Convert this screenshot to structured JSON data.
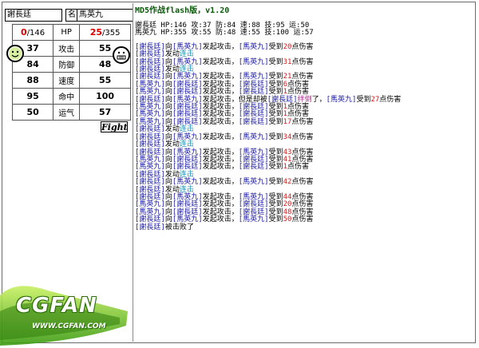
{
  "players": {
    "p1": {
      "name": "謝長廷",
      "hp_cur": "0",
      "hp_max": "/146",
      "atk": "37",
      "def": "84",
      "spd": "88",
      "hit": "95",
      "luck": "50"
    },
    "p2": {
      "name": "馬英九",
      "hp_cur": "25",
      "hp_max": "/355",
      "atk": "55",
      "def": "48",
      "spd": "55",
      "hit": "100",
      "luck": "57"
    }
  },
  "labels": {
    "name": "名",
    "hp": "HP",
    "atk": "攻击",
    "def": "防御",
    "spd": "速度",
    "hit": "命中",
    "luck": "运气"
  },
  "fight_button": "Fight",
  "log": {
    "title": "MD5作战flash版，v1.20",
    "stats_line1": "謝長廷  HP:146 攻:37 防:84 速:88 技:95 运:50",
    "stats_line2": "馬英九  HP:355 攻:55 防:48 速:55 技:100 运:57",
    "entries": [
      [
        {
          "t": "[謝長廷]",
          "c": "blue"
        },
        {
          "t": "向"
        },
        {
          "t": "[馬英九]",
          "c": "blue"
        },
        {
          "t": "发起攻击，"
        },
        {
          "t": "[馬英九]",
          "c": "blue"
        },
        {
          "t": "受到"
        },
        {
          "t": "20",
          "c": "red"
        },
        {
          "t": "点伤害"
        }
      ],
      [
        {
          "t": "[謝長廷]",
          "c": "blue"
        },
        {
          "t": "发动"
        },
        {
          "t": "连击",
          "c": "cyan"
        }
      ],
      [
        {
          "t": "[謝長廷]",
          "c": "blue"
        },
        {
          "t": "向"
        },
        {
          "t": "[馬英九]",
          "c": "blue"
        },
        {
          "t": "发起攻击，"
        },
        {
          "t": "[馬英九]",
          "c": "blue"
        },
        {
          "t": "受到"
        },
        {
          "t": "31",
          "c": "red"
        },
        {
          "t": "点伤害"
        }
      ],
      [
        {
          "t": "[謝長廷]",
          "c": "blue"
        },
        {
          "t": "发动"
        },
        {
          "t": "连击",
          "c": "cyan"
        }
      ],
      [
        {
          "t": "[謝長廷]",
          "c": "blue"
        },
        {
          "t": "向"
        },
        {
          "t": "[馬英九]",
          "c": "blue"
        },
        {
          "t": "发起攻击，"
        },
        {
          "t": "[馬英九]",
          "c": "blue"
        },
        {
          "t": "受到"
        },
        {
          "t": "21",
          "c": "red"
        },
        {
          "t": "点伤害"
        }
      ],
      [
        {
          "t": "[馬英九]",
          "c": "blue"
        },
        {
          "t": "向"
        },
        {
          "t": "[謝長廷]",
          "c": "blue"
        },
        {
          "t": "发起攻击，"
        },
        {
          "t": "[謝長廷]",
          "c": "blue"
        },
        {
          "t": "受到"
        },
        {
          "t": "6",
          "c": "red"
        },
        {
          "t": "点伤害"
        }
      ],
      [
        {
          "t": "[馬英九]",
          "c": "blue"
        },
        {
          "t": "向"
        },
        {
          "t": "[謝長廷]",
          "c": "blue"
        },
        {
          "t": "发起攻击，"
        },
        {
          "t": "[謝長廷]",
          "c": "blue"
        },
        {
          "t": "受到"
        },
        {
          "t": "1",
          "c": "red"
        },
        {
          "t": "点伤害"
        }
      ],
      [
        {
          "t": "[謝長廷]",
          "c": "blue"
        },
        {
          "t": "向"
        },
        {
          "t": "[馬英九]",
          "c": "blue"
        },
        {
          "t": "发起攻击，但是却被"
        },
        {
          "t": "[謝長廷]",
          "c": "blue"
        },
        {
          "t": "绊倒",
          "c": "pink"
        },
        {
          "t": "了，"
        },
        {
          "t": "[馬英九]",
          "c": "blue"
        },
        {
          "t": "受到"
        },
        {
          "t": "27",
          "c": "red"
        },
        {
          "t": "点伤害"
        }
      ],
      [
        {
          "t": "[馬英九]",
          "c": "blue"
        },
        {
          "t": "向"
        },
        {
          "t": "[謝長廷]",
          "c": "blue"
        },
        {
          "t": "发起攻击，"
        },
        {
          "t": "[謝長廷]",
          "c": "blue"
        },
        {
          "t": "受到"
        },
        {
          "t": "1",
          "c": "red"
        },
        {
          "t": "点伤害"
        }
      ],
      [
        {
          "t": "[馬英九]",
          "c": "blue"
        },
        {
          "t": "向"
        },
        {
          "t": "[謝長廷]",
          "c": "blue"
        },
        {
          "t": "发起攻击，"
        },
        {
          "t": "[謝長廷]",
          "c": "blue"
        },
        {
          "t": "受到"
        },
        {
          "t": "1",
          "c": "red"
        },
        {
          "t": "点伤害"
        }
      ],
      [
        {
          "t": "[馬英九]",
          "c": "blue"
        },
        {
          "t": "向"
        },
        {
          "t": "[謝長廷]",
          "c": "blue"
        },
        {
          "t": "发起攻击，"
        },
        {
          "t": "[謝長廷]",
          "c": "blue"
        },
        {
          "t": "受到"
        },
        {
          "t": "17",
          "c": "red"
        },
        {
          "t": "点伤害"
        }
      ],
      [
        {
          "t": "[謝長廷]",
          "c": "blue"
        },
        {
          "t": "发动"
        },
        {
          "t": "连击",
          "c": "cyan"
        }
      ],
      [
        {
          "t": "[謝長廷]",
          "c": "blue"
        },
        {
          "t": "向"
        },
        {
          "t": "[馬英九]",
          "c": "blue"
        },
        {
          "t": "发起攻击，"
        },
        {
          "t": "[馬英九]",
          "c": "blue"
        },
        {
          "t": "受到"
        },
        {
          "t": "34",
          "c": "red"
        },
        {
          "t": "点伤害"
        }
      ],
      [
        {
          "t": "[謝長廷]",
          "c": "blue"
        },
        {
          "t": "发动"
        },
        {
          "t": "连击",
          "c": "cyan"
        }
      ],
      [
        {
          "t": "[謝長廷]",
          "c": "blue"
        },
        {
          "t": "向"
        },
        {
          "t": "[馬英九]",
          "c": "blue"
        },
        {
          "t": "发起攻击，"
        },
        {
          "t": "[馬英九]",
          "c": "blue"
        },
        {
          "t": "受到"
        },
        {
          "t": "43",
          "c": "red"
        },
        {
          "t": "点伤害"
        }
      ],
      [
        {
          "t": "[馬英九]",
          "c": "blue"
        },
        {
          "t": "向"
        },
        {
          "t": "[謝長廷]",
          "c": "blue"
        },
        {
          "t": "发起攻击，"
        },
        {
          "t": "[謝長廷]",
          "c": "blue"
        },
        {
          "t": "受到"
        },
        {
          "t": "41",
          "c": "red"
        },
        {
          "t": "点伤害"
        }
      ],
      [
        {
          "t": "[馬英九]",
          "c": "blue"
        },
        {
          "t": "向"
        },
        {
          "t": "[謝長廷]",
          "c": "blue"
        },
        {
          "t": "发起攻击，"
        },
        {
          "t": "[謝長廷]",
          "c": "blue"
        },
        {
          "t": "受到"
        },
        {
          "t": "1",
          "c": "red"
        },
        {
          "t": "点伤害"
        }
      ],
      [
        {
          "t": "[謝長廷]",
          "c": "blue"
        },
        {
          "t": "发动"
        },
        {
          "t": "连击",
          "c": "cyan"
        }
      ],
      [
        {
          "t": "[謝長廷]",
          "c": "blue"
        },
        {
          "t": "向"
        },
        {
          "t": "[馬英九]",
          "c": "blue"
        },
        {
          "t": "发起攻击，"
        },
        {
          "t": "[馬英九]",
          "c": "blue"
        },
        {
          "t": "受到"
        },
        {
          "t": "42",
          "c": "red"
        },
        {
          "t": "点伤害"
        }
      ],
      [
        {
          "t": "[謝長廷]",
          "c": "blue"
        },
        {
          "t": "发动"
        },
        {
          "t": "连击",
          "c": "cyan"
        }
      ],
      [
        {
          "t": "[謝長廷]",
          "c": "blue"
        },
        {
          "t": "向"
        },
        {
          "t": "[馬英九]",
          "c": "blue"
        },
        {
          "t": "发起攻击，"
        },
        {
          "t": "[馬英九]",
          "c": "blue"
        },
        {
          "t": "受到"
        },
        {
          "t": "44",
          "c": "red"
        },
        {
          "t": "点伤害"
        }
      ],
      [
        {
          "t": "[馬英九]",
          "c": "blue"
        },
        {
          "t": "向"
        },
        {
          "t": "[謝長廷]",
          "c": "blue"
        },
        {
          "t": "发起攻击，"
        },
        {
          "t": "[謝長廷]",
          "c": "blue"
        },
        {
          "t": "受到"
        },
        {
          "t": "20",
          "c": "red"
        },
        {
          "t": "点伤害"
        }
      ],
      [
        {
          "t": "[馬英九]",
          "c": "blue"
        },
        {
          "t": "向"
        },
        {
          "t": "[謝長廷]",
          "c": "blue"
        },
        {
          "t": "发起攻击，"
        },
        {
          "t": "[謝長廷]",
          "c": "blue"
        },
        {
          "t": "受到"
        },
        {
          "t": "48",
          "c": "red"
        },
        {
          "t": "点伤害"
        }
      ],
      [
        {
          "t": "[謝長廷]",
          "c": "blue"
        },
        {
          "t": "向"
        },
        {
          "t": "[馬英九]",
          "c": "blue"
        },
        {
          "t": "发起攻击，"
        },
        {
          "t": "[馬英九]",
          "c": "blue"
        },
        {
          "t": "受到"
        },
        {
          "t": "50",
          "c": "red"
        },
        {
          "t": "点伤害"
        }
      ],
      [
        {
          "t": "[謝長廷]",
          "c": "blue"
        },
        {
          "t": "被击败了"
        }
      ]
    ]
  },
  "logo": {
    "brand": "CGFAN",
    "url": "WWW.CGFAN.COM"
  },
  "colors": {
    "name_blue": "#1a1aa8",
    "damage_red": "#d02020",
    "combo_cyan": "#1b8fb0",
    "trip_pink": "#b03090",
    "title_green": "#0a5a0a",
    "hp_red": "#e00000"
  }
}
